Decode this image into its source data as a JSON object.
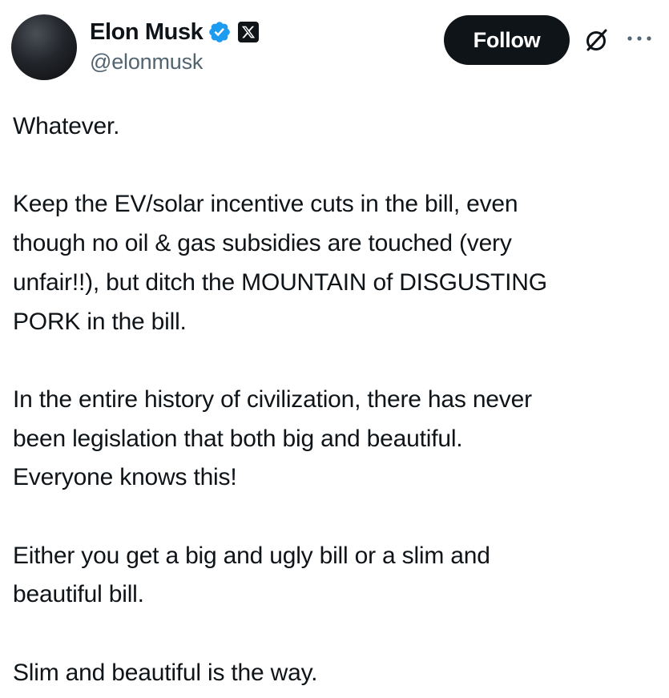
{
  "author": {
    "display_name": "Elon Musk",
    "handle": "@elonmusk",
    "verified_color": "#1d9bf0"
  },
  "actions": {
    "follow_label": "Follow"
  },
  "icons": {
    "avatar": "avatar-image",
    "verified": "verified-badge-icon",
    "affiliate": "x-logo-icon",
    "grok": "grok-icon",
    "more": "more-options-icon"
  },
  "tweet": {
    "paragraphs": [
      "Whatever.",
      "Keep the EV/solar incentive cuts in the bill, even\nthough no oil & gas subsidies are touched (very\nunfair!!), but ditch the MOUNTAIN of DISGUSTING\nPORK in the bill.",
      "In the entire history of civilization, there has never\nbeen legislation that both big and beautiful.\nEveryone knows this!",
      "Either you get a big and ugly bill or a slim and\nbeautiful bill.",
      "Slim and beautiful is the way."
    ]
  }
}
